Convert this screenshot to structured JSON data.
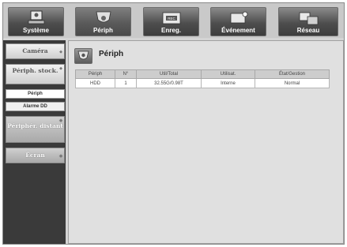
{
  "tabs": [
    {
      "label": "Système",
      "icon": "system-icon"
    },
    {
      "label": "Périph",
      "icon": "camera-icon"
    },
    {
      "label": "Enreg.",
      "icon": "record-icon"
    },
    {
      "label": "Événement",
      "icon": "event-icon"
    },
    {
      "label": "Réseau",
      "icon": "network-icon"
    }
  ],
  "sidebar": {
    "items": [
      {
        "label": "Caméra"
      },
      {
        "label": "Périph. stock."
      },
      {
        "label": "Périph"
      },
      {
        "label": "Alarme DD"
      },
      {
        "label": "Périphér. distant"
      },
      {
        "label": "Écran"
      }
    ]
  },
  "main": {
    "title": "Périph",
    "table": {
      "headers": [
        "Périph",
        "N°",
        "Util/Total",
        "Utilisat.",
        "État/Gestion"
      ],
      "rows": [
        [
          "HDD",
          "1",
          "32.55G/0.98T",
          "Interne",
          "Normal"
        ]
      ]
    }
  }
}
